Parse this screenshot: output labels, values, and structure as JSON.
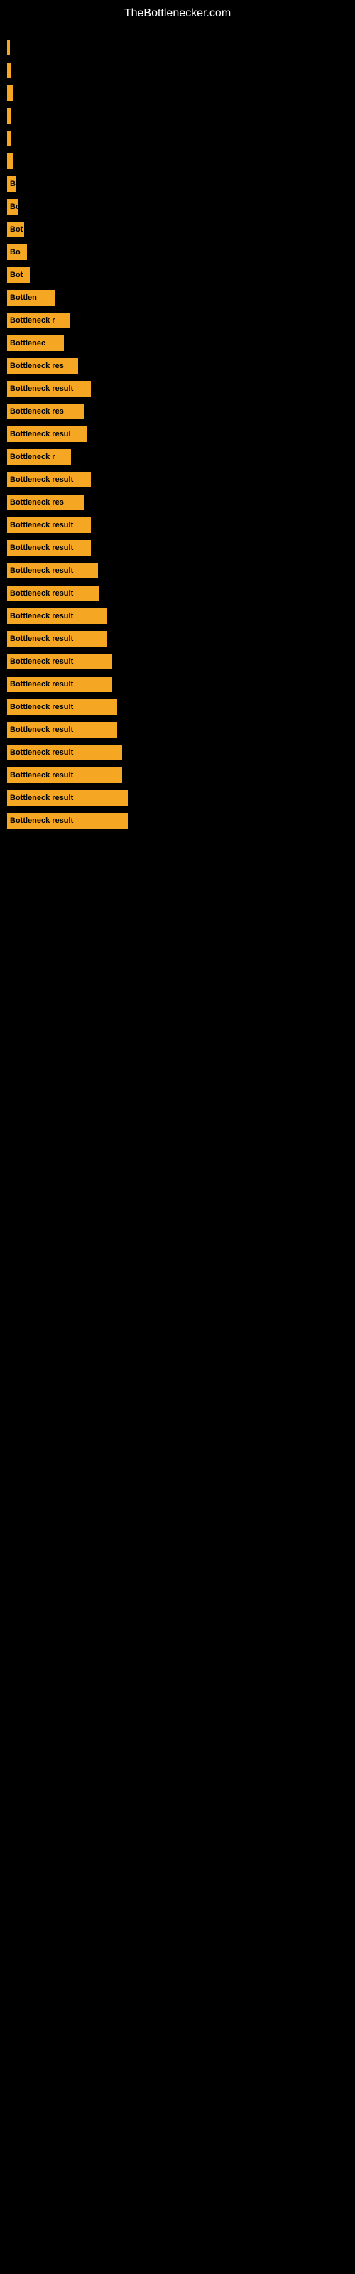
{
  "site": {
    "title": "TheBottlenecker.com"
  },
  "bars": [
    {
      "id": 1,
      "width": 4,
      "label": ""
    },
    {
      "id": 2,
      "width": 5,
      "label": ""
    },
    {
      "id": 3,
      "width": 8,
      "label": ""
    },
    {
      "id": 4,
      "width": 5,
      "label": ""
    },
    {
      "id": 5,
      "width": 5,
      "label": ""
    },
    {
      "id": 6,
      "width": 9,
      "label": ""
    },
    {
      "id": 7,
      "width": 12,
      "label": "B"
    },
    {
      "id": 8,
      "width": 16,
      "label": "Bo"
    },
    {
      "id": 9,
      "width": 24,
      "label": "Bot"
    },
    {
      "id": 10,
      "width": 28,
      "label": "Bo"
    },
    {
      "id": 11,
      "width": 32,
      "label": "Bot"
    },
    {
      "id": 12,
      "width": 68,
      "label": "Bottlen"
    },
    {
      "id": 13,
      "width": 88,
      "label": "Bottleneck r"
    },
    {
      "id": 14,
      "width": 80,
      "label": "Bottlenec"
    },
    {
      "id": 15,
      "width": 100,
      "label": "Bottleneck res"
    },
    {
      "id": 16,
      "width": 118,
      "label": "Bottleneck result"
    },
    {
      "id": 17,
      "width": 108,
      "label": "Bottleneck res"
    },
    {
      "id": 18,
      "width": 112,
      "label": "Bottleneck resul"
    },
    {
      "id": 19,
      "width": 90,
      "label": "Bottleneck r"
    },
    {
      "id": 20,
      "width": 118,
      "label": "Bottleneck result"
    },
    {
      "id": 21,
      "width": 108,
      "label": "Bottleneck res"
    },
    {
      "id": 22,
      "width": 118,
      "label": "Bottleneck result"
    },
    {
      "id": 23,
      "width": 118,
      "label": "Bottleneck result"
    },
    {
      "id": 24,
      "width": 128,
      "label": "Bottleneck result"
    },
    {
      "id": 25,
      "width": 130,
      "label": "Bottleneck result"
    },
    {
      "id": 26,
      "width": 140,
      "label": "Bottleneck result"
    },
    {
      "id": 27,
      "width": 140,
      "label": "Bottleneck result"
    },
    {
      "id": 28,
      "width": 148,
      "label": "Bottleneck result"
    },
    {
      "id": 29,
      "width": 148,
      "label": "Bottleneck result"
    },
    {
      "id": 30,
      "width": 155,
      "label": "Bottleneck result"
    },
    {
      "id": 31,
      "width": 155,
      "label": "Bottleneck result"
    },
    {
      "id": 32,
      "width": 162,
      "label": "Bottleneck result"
    },
    {
      "id": 33,
      "width": 162,
      "label": "Bottleneck result"
    },
    {
      "id": 34,
      "width": 170,
      "label": "Bottleneck result"
    },
    {
      "id": 35,
      "width": 170,
      "label": "Bottleneck result"
    }
  ]
}
